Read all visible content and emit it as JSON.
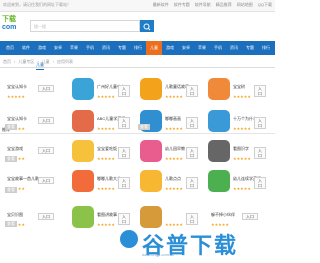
{
  "topbar": {
    "left_text": "欢迎来到，请记住我们的网址下载站！",
    "links": [
      "最新软件",
      "软件专题",
      "软件导航",
      "精品推荐",
      "网站地图",
      "QQ下载"
    ]
  },
  "header": {
    "logo_top": "下载",
    "logo_bottom": "com",
    "search_placeholder": "搜一搜"
  },
  "nav": {
    "items": [
      "首页",
      "软件",
      "游戏",
      "安卓",
      "苹果",
      "手机",
      "资讯",
      "专题",
      "排行",
      "儿童",
      "游戏",
      "安卓",
      "苹果",
      "手机",
      "资讯",
      "专题",
      "排行",
      "教程"
    ],
    "active_index": 9
  },
  "breadcrumb": [
    "首页",
    "儿童专区",
    "儿童",
    "应用列表"
  ],
  "tab_active_label": "儿童",
  "section_title": "推荐",
  "colors": {
    "nav_bg": "#1b6fbd",
    "nav_active": "#eb6f1e",
    "star": "#f5a623",
    "watermark": "#2a8fd6"
  },
  "cards": [
    {
      "name": "宝宝认知卡",
      "stars": "★★★★★",
      "btn": "入口",
      "icon": "",
      "col": 0,
      "row": 0
    },
    {
      "name": "广州好儿童中心",
      "stars": "★★★★★",
      "btn": "入口",
      "icon": "medical-cross-icon",
      "col": 1,
      "row": 0
    },
    {
      "name": "儿歌童话故事",
      "stars": "★★★★★",
      "btn": "入口",
      "icon": "smiley-face-icon",
      "col": 2,
      "row": 0
    },
    {
      "name": "宝宝树",
      "stars": "★★★★★",
      "btn": "入口",
      "icon": "bear-icon",
      "col": 3,
      "row": 0
    },
    {
      "name": "宝宝认知卡",
      "stars": "★★★★★",
      "btn": "入口",
      "icon": "",
      "col": 0,
      "row": 1
    },
    {
      "name": "ABC儿童学英语",
      "stars": "★★★★★",
      "btn": "入口",
      "icon": "abc-icon",
      "col": 1,
      "row": 1
    },
    {
      "name": "嘟嘟画画",
      "stars": "★★★★★",
      "btn": "入口",
      "icon": "bird-icon",
      "col": 2,
      "row": 1
    },
    {
      "name": "十万个为什么",
      "stars": "★★★★★",
      "btn": "入口",
      "icon": "question-icon",
      "col": 3,
      "row": 1
    },
    {
      "name": "宝宝游戏",
      "stars": "★★★★★",
      "btn": "入口",
      "icon": "",
      "col": 0,
      "row": 2
    },
    {
      "name": "宝宝爱吃饭",
      "stars": "★★★★★",
      "btn": "入口",
      "icon": "kid-face-icon",
      "col": 1,
      "row": 2
    },
    {
      "name": "幼儿园早教",
      "stars": "★★★★★",
      "btn": "入口",
      "icon": "flower-icon",
      "col": 2,
      "row": 2
    },
    {
      "name": "看图识字",
      "stars": "★★★★★",
      "btn": "入口",
      "icon": "zebra-icon",
      "col": 3,
      "row": 2
    },
    {
      "name": "宝宝故事一首儿歌",
      "stars": "★★★★★",
      "btn": "入口",
      "icon": "",
      "col": 0,
      "row": 3
    },
    {
      "name": "嘟嘟儿歌大全",
      "stars": "★★★★★",
      "btn": "入口",
      "icon": "cartoon-icon",
      "col": 1,
      "row": 3
    },
    {
      "name": "儿歌点点",
      "stars": "★★★★★",
      "btn": "入口",
      "icon": "kid-icon",
      "col": 2,
      "row": 3
    },
    {
      "name": "幼儿连续学英语",
      "stars": "★★★★★",
      "btn": "入口",
      "icon": "tea-icon",
      "col": 3,
      "row": 3
    },
    {
      "name": "宝贝识图",
      "stars": "★★★★★",
      "btn": "入口",
      "icon": "",
      "col": 0,
      "row": 4
    },
    {
      "name": "看图讲故事",
      "stars": "★★★★★",
      "btn": "入口",
      "icon": "dog-icon",
      "col": 1,
      "row": 4
    },
    {
      "name": "",
      "stars": "★★★★★",
      "btn": "入口",
      "icon": "monkey-icon",
      "col": 2,
      "row": 4
    },
    {
      "name": "躲不掉小伙伴",
      "stars": "★★★★★",
      "btn": "入口",
      "icon": "",
      "col": 3,
      "row": 4
    }
  ],
  "tags": [
    "查看",
    "查看",
    "查看",
    "查看",
    "查看"
  ],
  "watermark": {
    "text": "谷普下载",
    "sub": "www.cngp.com.cn"
  }
}
